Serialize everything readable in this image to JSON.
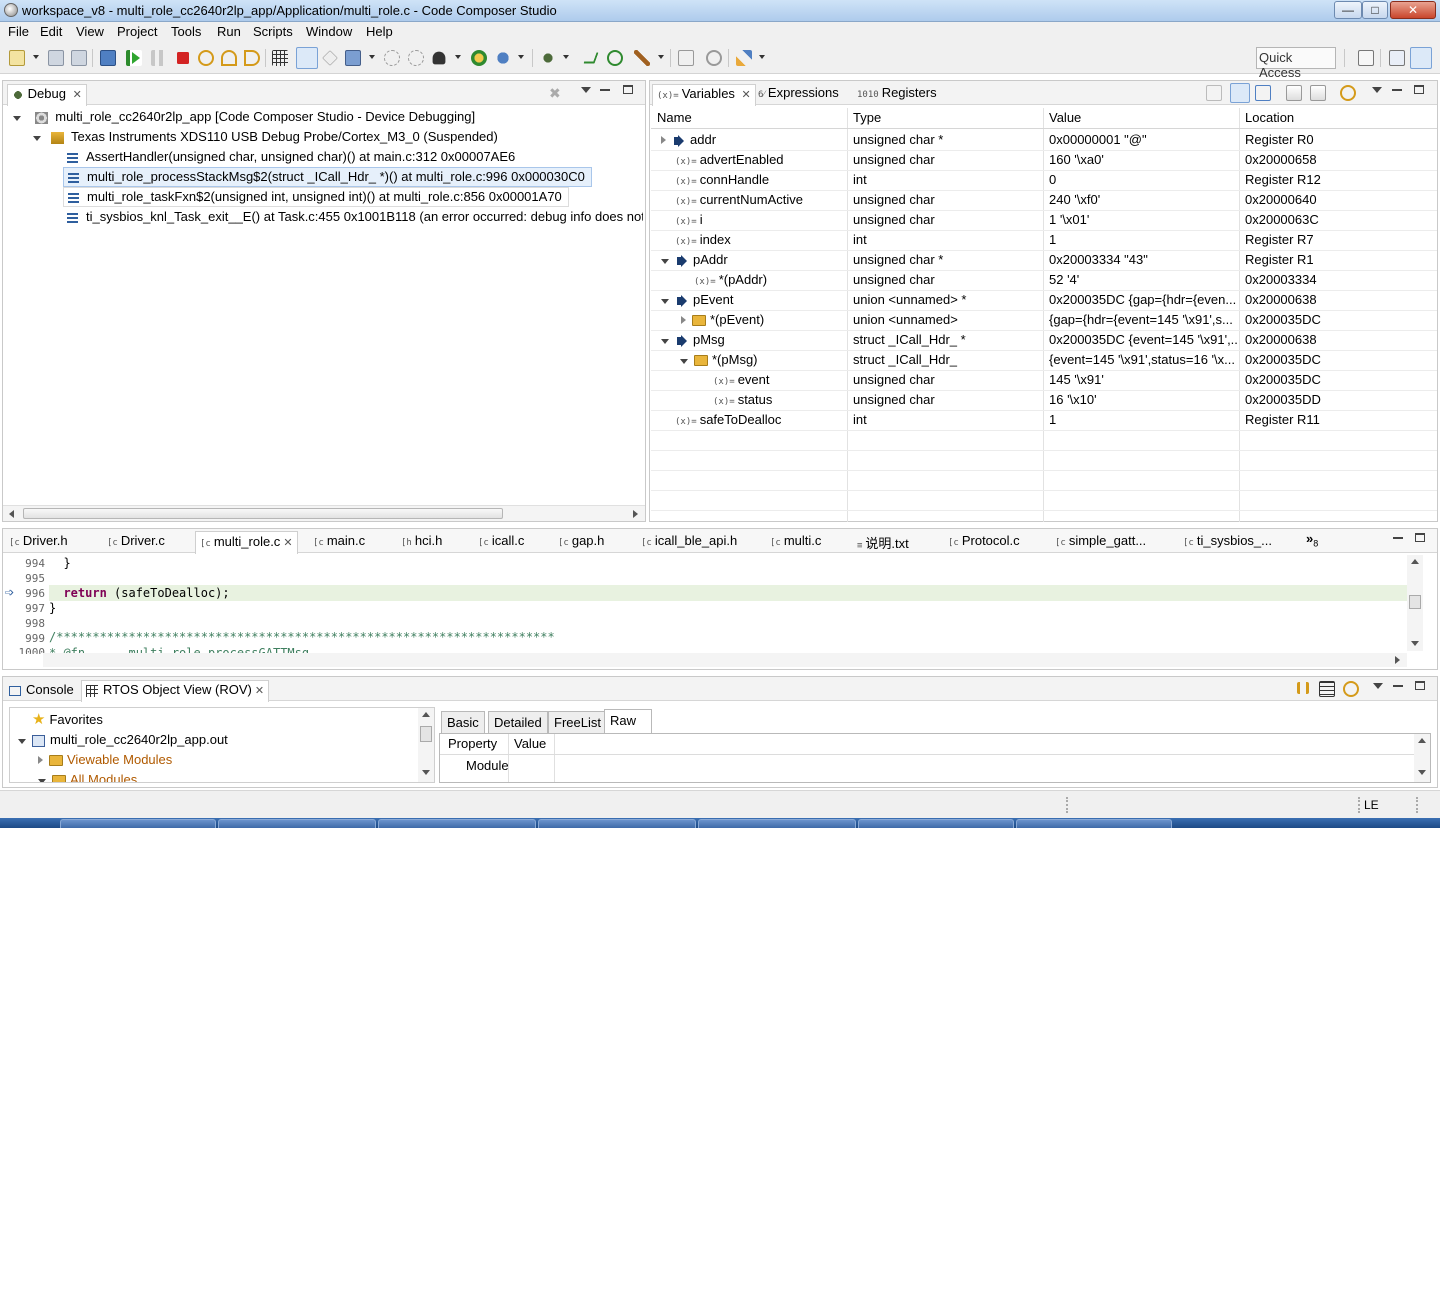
{
  "window": {
    "title": "workspace_v8 - multi_role_cc2640r2lp_app/Application/multi_role.c - Code Composer Studio",
    "minimize": "—",
    "maximize": "□",
    "close": "✕"
  },
  "menu": [
    "File",
    "Edit",
    "View",
    "Project",
    "Tools",
    "Run",
    "Scripts",
    "Window",
    "Help"
  ],
  "quick_access": "Quick Access",
  "debug": {
    "tab_label": "Debug",
    "rows": [
      "multi_role_cc2640r2lp_app [Code Composer Studio - Device Debugging]",
      "Texas Instruments XDS110 USB Debug Probe/Cortex_M3_0 (Suspended)",
      "AssertHandler(unsigned char, unsigned char)() at main.c:312 0x00007AE6",
      "multi_role_processStackMsg$2(struct _ICall_Hdr_ *)() at multi_role.c:996 0x000030C0",
      "multi_role_taskFxn$2(unsigned int, unsigned int)() at multi_role.c:856 0x00001A70",
      "ti_sysbios_knl_Task_exit__E() at Task.c:455 0x1001B118  (an error occurred: debug info does not"
    ]
  },
  "variables": {
    "tabs": [
      "Variables",
      "Expressions",
      "Registers"
    ],
    "columns": [
      "Name",
      "Type",
      "Value",
      "Location"
    ],
    "rows": [
      {
        "name": "addr",
        "type": "unsigned char *",
        "value": "0x00000001 \"@\"",
        "location": "Register R0"
      },
      {
        "name": "advertEnabled",
        "type": "unsigned char",
        "value": "160 '\\xa0'",
        "location": "0x20000658"
      },
      {
        "name": "connHandle",
        "type": "int",
        "value": "0",
        "location": "Register R12"
      },
      {
        "name": "currentNumActive",
        "type": "unsigned char",
        "value": "240 '\\xf0'",
        "location": "0x20000640"
      },
      {
        "name": "i",
        "type": "unsigned char",
        "value": "1 '\\x01'",
        "location": "0x2000063C"
      },
      {
        "name": "index",
        "type": "int",
        "value": "1",
        "location": "Register R7"
      },
      {
        "name": "pAddr",
        "type": "unsigned char *",
        "value": "0x20003334 \"43\"",
        "location": "Register R1"
      },
      {
        "name": "*(pAddr)",
        "type": "unsigned char",
        "value": "52 '4'",
        "location": "0x20003334"
      },
      {
        "name": "pEvent",
        "type": "union <unnamed> *",
        "value": "0x200035DC {gap={hdr={even...",
        "location": "0x20000638"
      },
      {
        "name": "*(pEvent)",
        "type": "union <unnamed>",
        "value": "{gap={hdr={event=145 '\\x91',s...",
        "location": "0x200035DC"
      },
      {
        "name": "pMsg",
        "type": "struct _ICall_Hdr_ *",
        "value": "0x200035DC {event=145 '\\x91',...",
        "location": "0x20000638"
      },
      {
        "name": "*(pMsg)",
        "type": "struct _ICall_Hdr_",
        "value": "{event=145 '\\x91',status=16 '\\x...",
        "location": "0x200035DC"
      },
      {
        "name": "event",
        "type": "unsigned char",
        "value": "145 '\\x91'",
        "location": "0x200035DC"
      },
      {
        "name": "status",
        "type": "unsigned char",
        "value": "16 '\\x10'",
        "location": "0x200035DD"
      },
      {
        "name": "safeToDealloc",
        "type": "int",
        "value": "1",
        "location": "Register R11"
      }
    ]
  },
  "editor": {
    "tabs": [
      "Driver.h",
      "Driver.c",
      "multi_role.c",
      "main.c",
      "hci.h",
      "icall.c",
      "gap.h",
      "icall_ble_api.h",
      "multi.c",
      "说明.txt",
      "Protocol.c",
      "simple_gatt...",
      "ti_sysbios_..."
    ],
    "overflow_count": "8",
    "line_numbers": [
      "994",
      "995",
      "996",
      "997",
      "998",
      "999",
      "1000"
    ],
    "code": {
      "l994": "  }",
      "l996_kw": "return",
      "l996_rest": " (safeToDealloc);",
      "l997": "}",
      "l999": "/*********************************************************************",
      "l1000": "* @fn      multi_role_processGATTMsg"
    }
  },
  "bottom": {
    "tabs": [
      "Console",
      "RTOS Object View (ROV)"
    ],
    "tree": [
      "Favorites",
      "multi_role_cc2640r2lp_app.out",
      "Viewable Modules",
      "All Modules"
    ],
    "rov_tabs": [
      "Basic",
      "Detailed",
      "FreeList",
      "Raw"
    ],
    "columns": [
      "Property",
      "Value"
    ],
    "row1": "Module"
  },
  "status": {
    "insert_mode": "LE"
  }
}
